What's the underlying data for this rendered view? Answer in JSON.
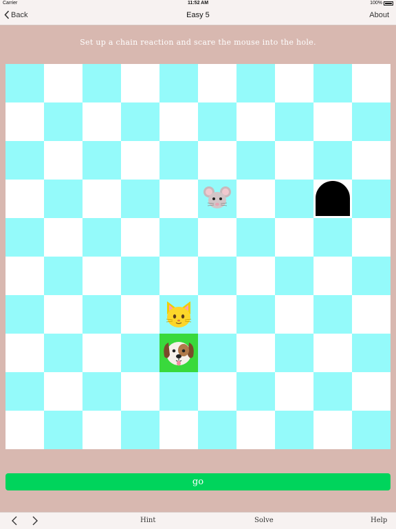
{
  "status": {
    "carrier": "Carrier",
    "time": "11:52 AM",
    "battery": "100%"
  },
  "nav": {
    "back_label": "Back",
    "title": "Easy 5",
    "about_label": "About"
  },
  "instructions": "Set up a chain reaction and scare the mouse into the hole.",
  "board": {
    "rows": 10,
    "cols": 10,
    "pieces": [
      {
        "name": "mouse",
        "row": 3,
        "col": 5
      },
      {
        "name": "mouse-hole",
        "row": 3,
        "col": 8
      },
      {
        "name": "cat",
        "row": 6,
        "col": 4
      },
      {
        "name": "dog",
        "row": 7,
        "col": 4,
        "highlight": "selected"
      }
    ],
    "colors": {
      "cyan": "#94fafa",
      "white": "#ffffff",
      "selected": "#39d93c"
    }
  },
  "go_label": "go",
  "toolbar": {
    "hint_label": "Hint",
    "solve_label": "Solve",
    "help_label": "Help"
  }
}
